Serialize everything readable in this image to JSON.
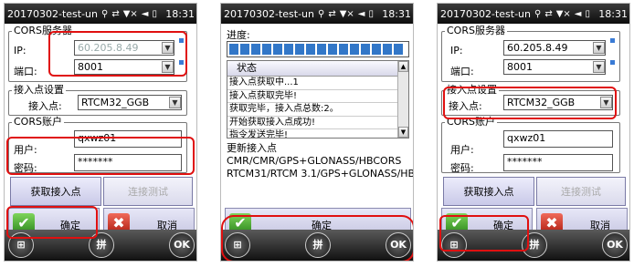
{
  "status_bar": {
    "title": "20170302-test-un",
    "icons": [
      "signal-icon",
      "sync-icon",
      "no-signal-icon",
      "volume-icon",
      "battery-icon"
    ],
    "time": "18:31"
  },
  "screen1": {
    "cors_group": "CORS服务器",
    "ip_label": "IP:",
    "ip_value": "60.205.8.49",
    "port_label": "端口:",
    "port_value": "8001",
    "mount_group": "接入点设置",
    "mount_label": "接入点:",
    "mount_value": "RTCM32_GGB",
    "account_group": "CORS账户",
    "user_label": "用户:",
    "user_value": "qxwz01",
    "pwd_label": "密码:",
    "pwd_value": "*******",
    "get_mount_btn": "获取接入点",
    "test_conn_btn": "连接测试",
    "ok_btn": "确定",
    "cancel_btn": "取消"
  },
  "screen2": {
    "progress_label": "进度:",
    "progress_fraction": 1.0,
    "list_header": "状态",
    "log": [
      "接入点获取中...1",
      "接入点获取完毕!",
      "获取完毕，接入点总数:2。",
      "开始获取接入点成功!",
      "指令发送完毕!"
    ],
    "mount_title": "更新接入点",
    "mounts": [
      "CMR/CMR/GPS+GLONASS/HBCORS",
      "RTCM31/RTCM 3.1/GPS+GLONASS/HBCOR"
    ],
    "ok_btn": "确定"
  },
  "screen3": {
    "cors_group": "CORS服务器",
    "ip_label": "IP:",
    "ip_value": "60.205.8.49",
    "port_label": "端口:",
    "port_value": "8001",
    "mount_group": "接入点设置",
    "mount_label": "接入点:",
    "mount_value": "RTCM32_GGB",
    "account_group": "CORS账户",
    "user_label": "用户:",
    "user_value": "qxwz01",
    "pwd_label": "密码:",
    "pwd_value": "*******",
    "get_mount_btn": "获取接入点",
    "test_conn_btn": "连接测试",
    "ok_btn": "确定",
    "cancel_btn": "取消"
  },
  "taskbar": {
    "start_label": "⊞",
    "ime_label": "拼",
    "ok_label": "OK"
  },
  "colors": {
    "highlight": "#e01010",
    "button": "#c9c9e8",
    "progress": "#3277c8"
  }
}
